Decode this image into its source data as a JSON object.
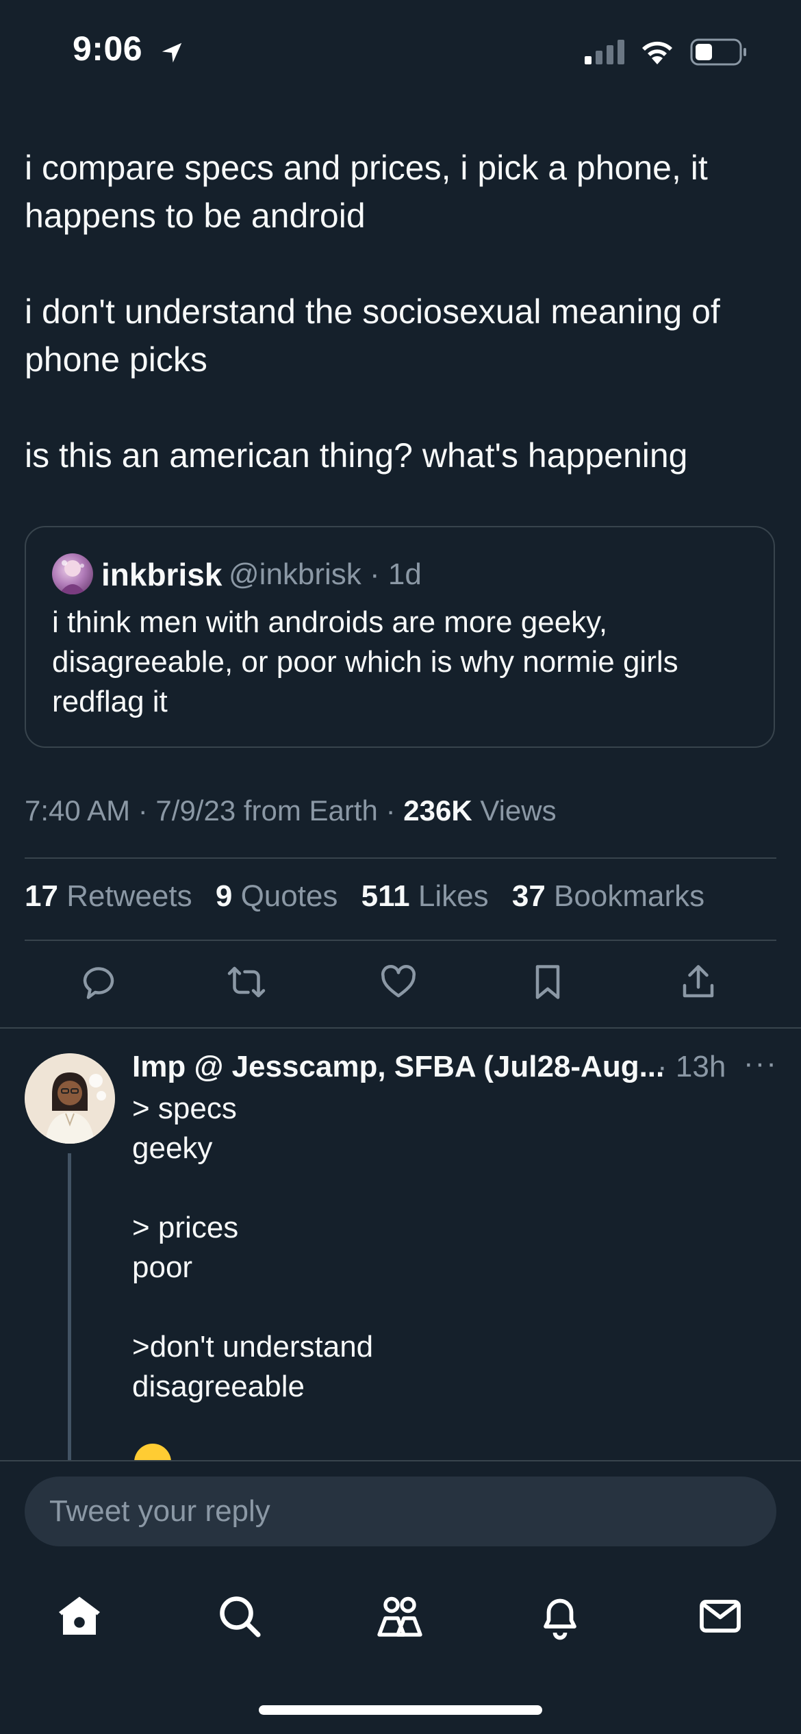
{
  "status_bar": {
    "time": "9:06"
  },
  "tweet": {
    "paragraphs": [
      "i compare specs and prices, i pick a phone, it\nhappens to be android",
      "i don't understand the sociosexual meaning of\nphone picks",
      "is this an american thing? what's happening"
    ],
    "quote": {
      "name": "inkbrisk",
      "handle_time": "@inkbrisk · 1d",
      "text": "i think men with androids are more geeky, disagreeable, or poor which is why normie girls redflag it"
    },
    "meta": {
      "time_date_source": "7:40 AM · 7/9/23 from Earth · ",
      "views_count": "236K",
      "views_label": " Views"
    },
    "stats": [
      {
        "count": "17",
        "label": "Retweets"
      },
      {
        "count": "9",
        "label": "Quotes"
      },
      {
        "count": "511",
        "label": "Likes"
      },
      {
        "count": "37",
        "label": "Bookmarks"
      }
    ]
  },
  "reply": {
    "name": "Imp @ Jesscamp, SFBA (Jul28-Aug...",
    "time": "· 13h",
    "more": "···",
    "paragraphs": [
      "> specs\ngeeky",
      "> prices\npoor",
      ">don't understand\ndisagreeable"
    ]
  },
  "composer": {
    "placeholder": "Tweet your reply"
  },
  "colors": {
    "background": "#15202b",
    "text": "#f7f9f9",
    "muted": "#8b98a5",
    "border": "#38444d",
    "input_bg": "#273340"
  }
}
